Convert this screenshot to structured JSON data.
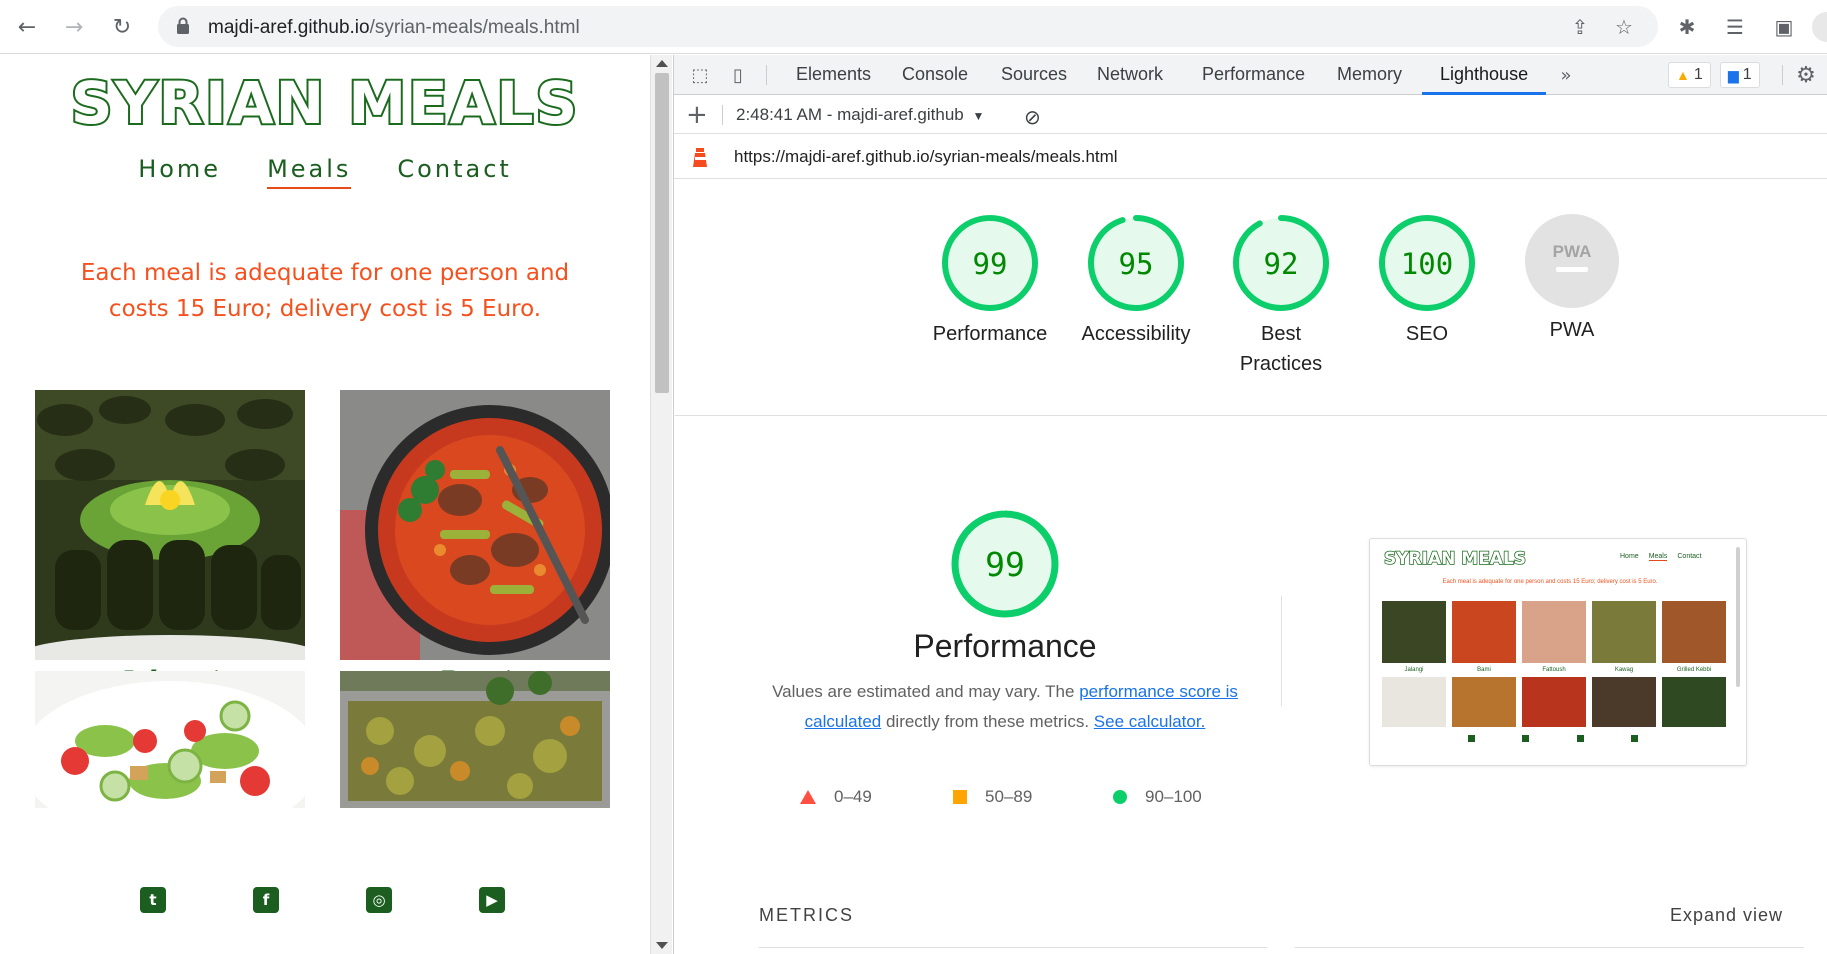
{
  "browser": {
    "url_host": "majdi-aref.github.io",
    "url_path": "/syrian-meals/meals.html"
  },
  "site": {
    "title": "SYRIAN MEALS",
    "nav": [
      "Home",
      "Meals",
      "Contact"
    ],
    "notice_line1": "Each meal is adequate for one person and",
    "notice_line2": "costs 15 Euro; delivery cost is 5 Euro.",
    "meals": [
      "Jalangi",
      "Bami"
    ]
  },
  "devtools": {
    "tabs": [
      "Elements",
      "Console",
      "Sources",
      "Network",
      "Performance",
      "Memory",
      "Lighthouse"
    ],
    "active_tab": "Lighthouse",
    "warnings_count": "1",
    "messages_count": "1",
    "report_selector": "2:48:41 AM - majdi-aref.github",
    "report_url": "https://majdi-aref.github.io/syrian-meals/meals.html"
  },
  "lighthouse": {
    "scores": [
      {
        "label": "Performance",
        "value": 99
      },
      {
        "label": "Accessibility",
        "value": 95
      },
      {
        "label": "Best Practices",
        "value": 92
      },
      {
        "label": "SEO",
        "value": 100
      }
    ],
    "pwa_label": "PWA",
    "pwa_badge_text": "PWA",
    "performance": {
      "value": 99,
      "title": "Performance",
      "desc_prefix": "Values are estimated and may vary. The ",
      "desc_link1": "performance score is calculated",
      "desc_mid": " directly from these metrics. ",
      "desc_link2": "See calculator."
    },
    "legend": [
      "0–49",
      "50–89",
      "90–100"
    ],
    "metrics_heading": "METRICS",
    "expand_label": "Expand view",
    "thumbnail": {
      "title": "SYRIAN MEALS",
      "nav": [
        "Home",
        "Meals",
        "Contact"
      ],
      "notice": "Each meal is adequate for one person and costs 15 Euro; delivery cost is 5 Euro.",
      "captions": [
        "Jalangi",
        "Bami",
        "Fattoush",
        "Kawag",
        "Grilled Kebbi"
      ]
    }
  },
  "colors": {
    "pass": "#0cce6b",
    "pass_text": "#008800",
    "pass_bg": "#e5f9ec",
    "average": "#ffa400",
    "fail": "#ff4e42",
    "brand_green": "#1b5e20",
    "accent_orange": "#f4511e",
    "link": "#1a73e8"
  }
}
